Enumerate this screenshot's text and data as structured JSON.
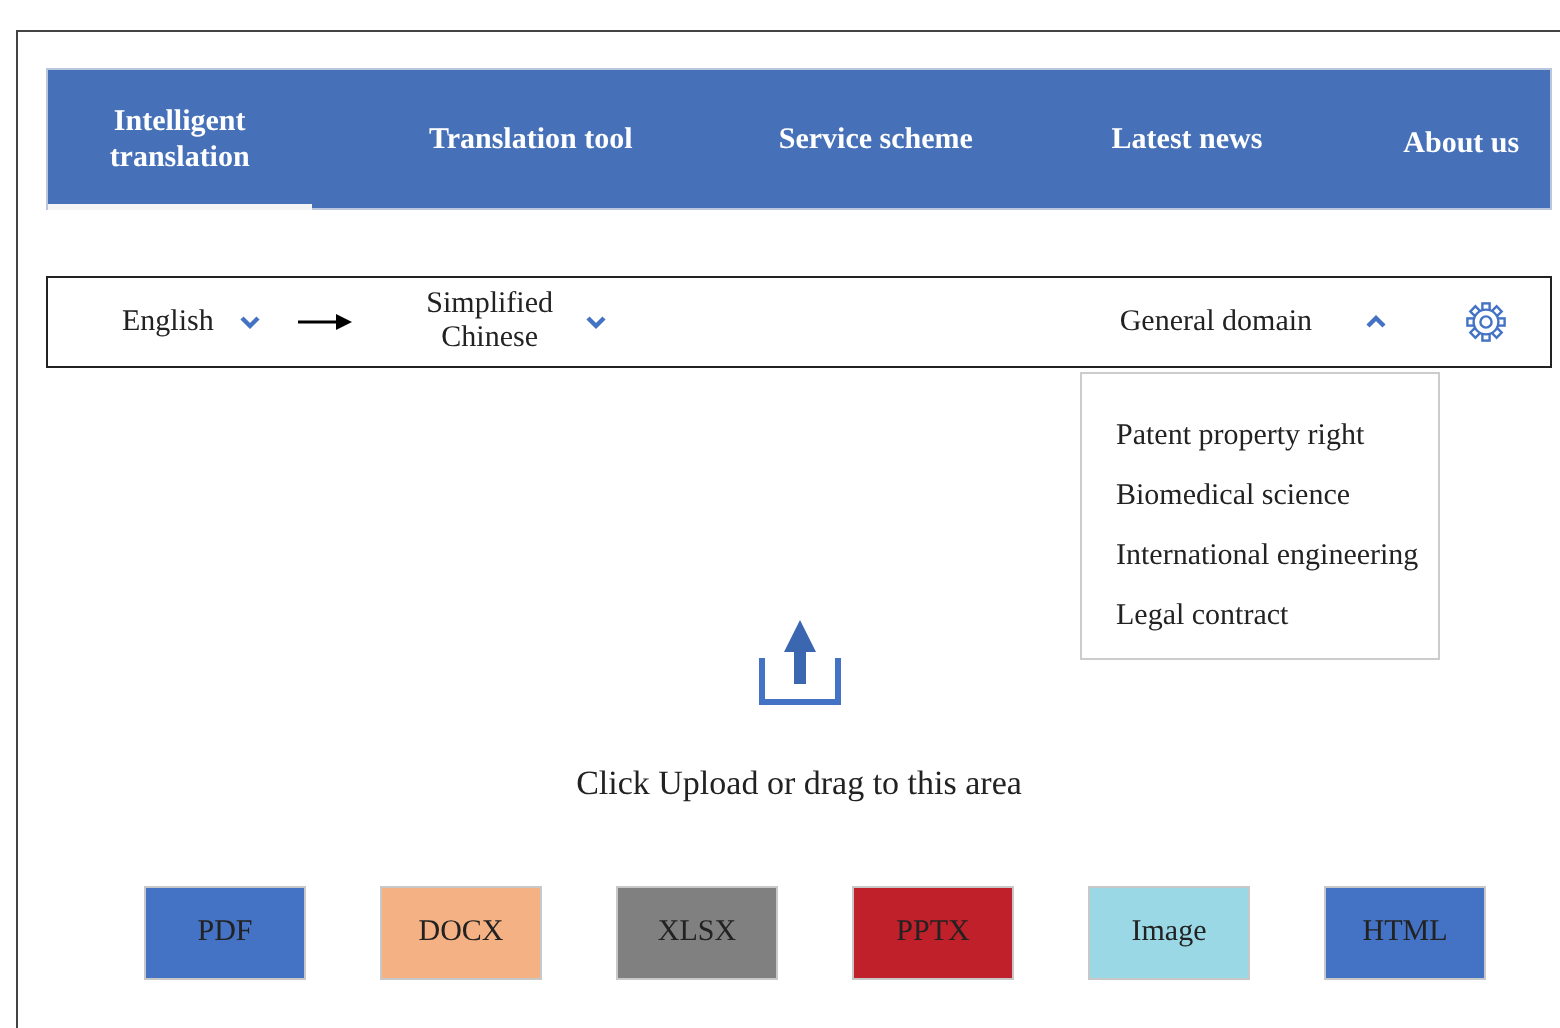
{
  "nav": [
    {
      "label": "Intelligent translation",
      "selected": true
    },
    {
      "label": "Translation tool",
      "selected": false
    },
    {
      "label": "Service scheme",
      "selected": false
    },
    {
      "label": "Latest news",
      "selected": false
    },
    {
      "label": "About us",
      "selected": false
    }
  ],
  "selector": {
    "source": "English",
    "target": "Simplified Chinese",
    "domain": "General domain",
    "expanded": true
  },
  "domain_options": [
    "Patent property right",
    "Biomedical science",
    "International engineering",
    "Legal contract"
  ],
  "upload": {
    "text": "Click Upload or drag to this area"
  },
  "file_types": [
    {
      "label": "PDF",
      "color": "#4472c4"
    },
    {
      "label": "DOCX",
      "color": "#f4b183"
    },
    {
      "label": "XLSX",
      "color": "#808080"
    },
    {
      "label": "PPTX",
      "color": "#c0202a"
    },
    {
      "label": "Image",
      "color": "#9ad8e6"
    },
    {
      "label": "HTML",
      "color": "#4472c4"
    }
  ]
}
